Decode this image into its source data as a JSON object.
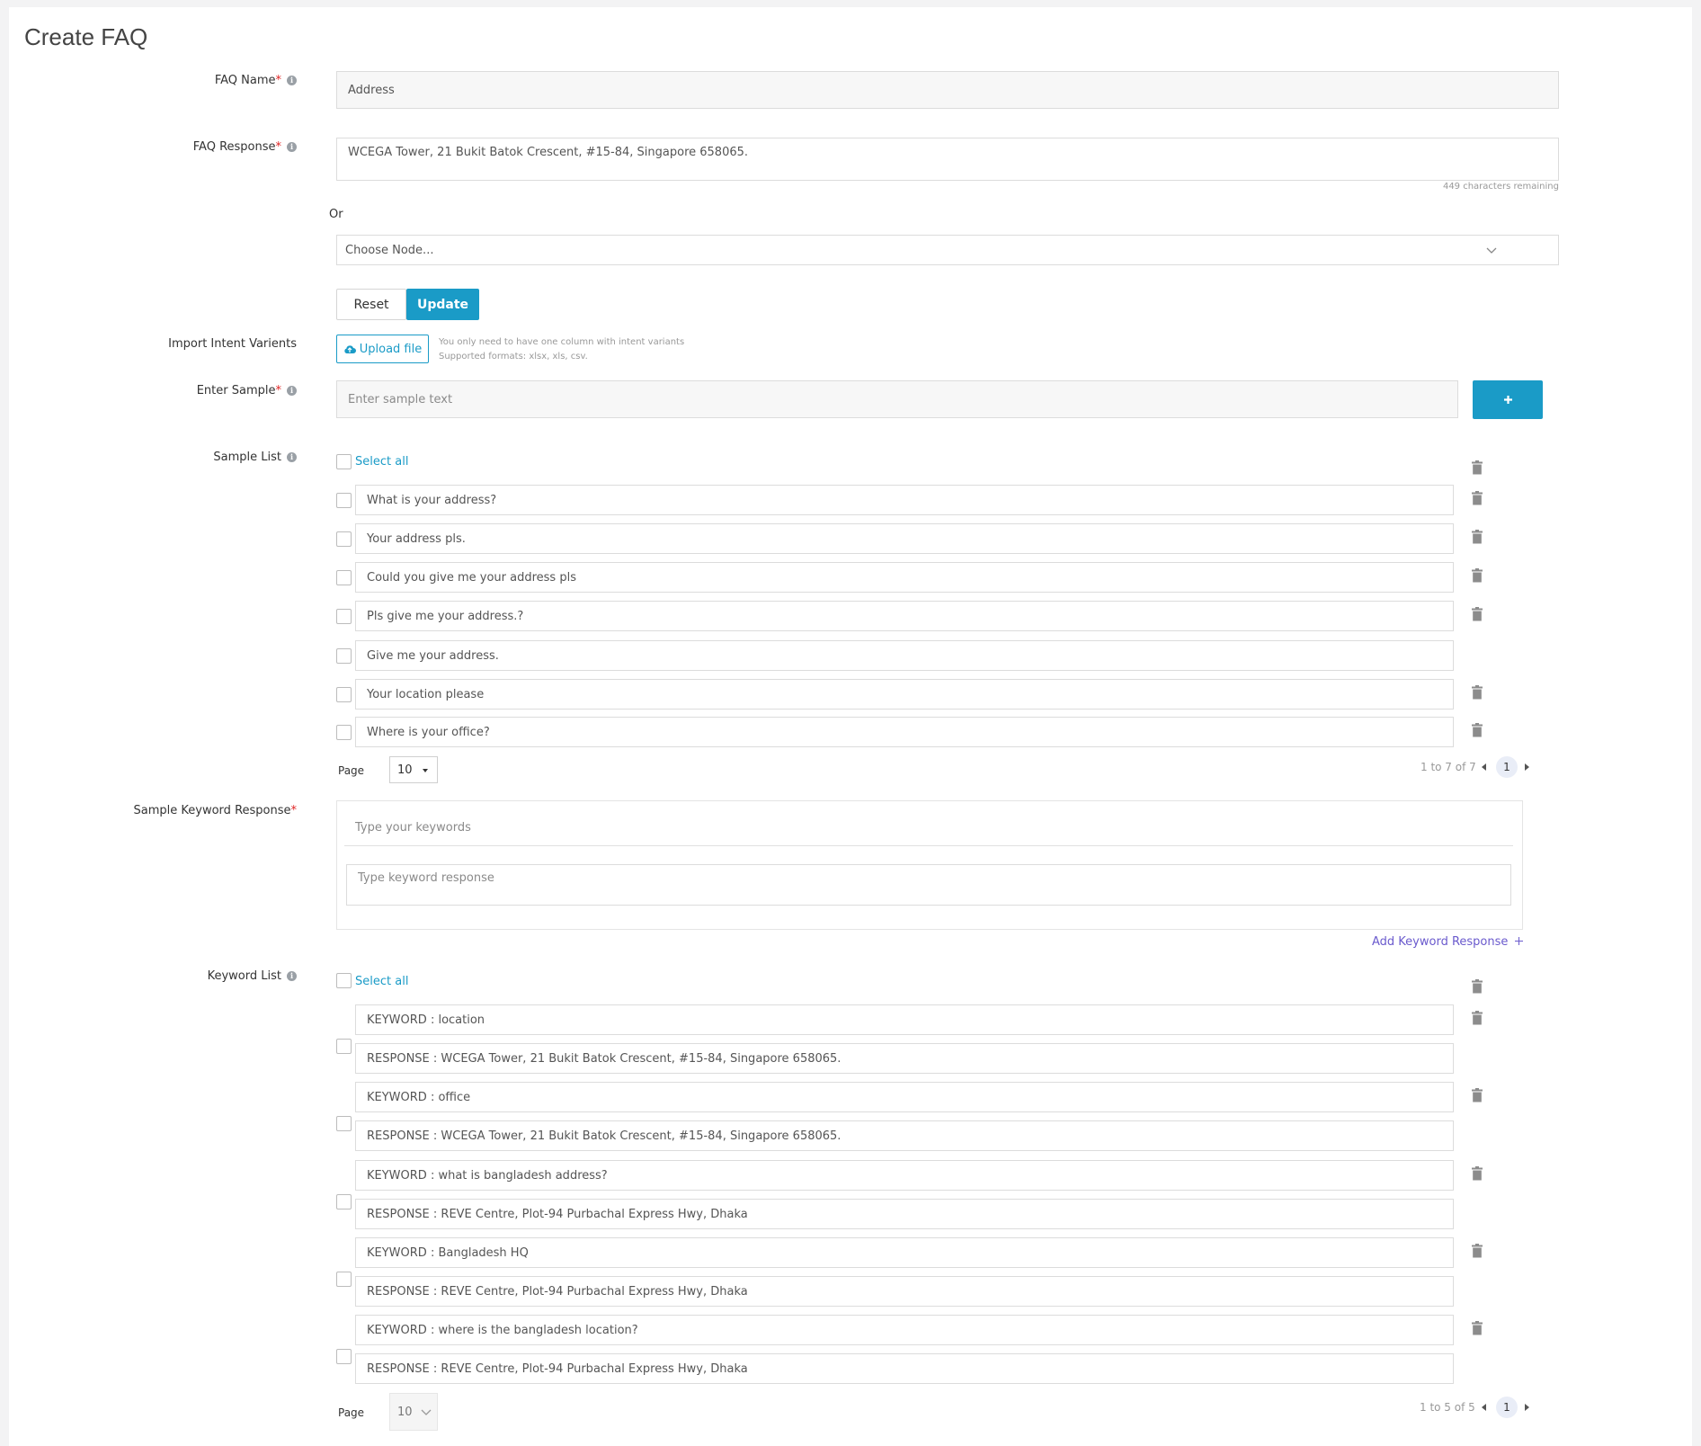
{
  "page": {
    "title": "Create FAQ"
  },
  "faq_name": {
    "label": "FAQ Name",
    "value": "Address"
  },
  "faq_response": {
    "label": "FAQ Response",
    "value": "WCEGA Tower, 21 Bukit Batok Crescent, #15-84, Singapore 658065.",
    "remaining": "449 characters remaining"
  },
  "or_text": "Or",
  "node_select": {
    "placeholder": "Choose Node..."
  },
  "buttons": {
    "reset": "Reset",
    "update": "Update",
    "add_sample": "+"
  },
  "import": {
    "label": "Import Intent Varients",
    "upload": "Upload file",
    "hint1": "You only need to have one column with intent variants",
    "hint2": "Supported formats: xlsx, xls, csv."
  },
  "sample_entry": {
    "label": "Enter Sample",
    "placeholder": "Enter sample text"
  },
  "sample_list": {
    "label": "Sample List",
    "select_all": "Select all",
    "items": [
      "What is your address?",
      "Your address pls.",
      "Could you give me your address pls",
      "Pls give me your address.?",
      "Give me your address.",
      "Your location please",
      "Where is your office?"
    ],
    "page_label": "Page",
    "page_size": "10",
    "range": "1 to 7 of 7",
    "current_page": "1"
  },
  "keyword_response": {
    "label": "Sample Keyword Response",
    "keywords_placeholder": "Type your keywords",
    "response_placeholder": "Type keyword response",
    "add_link": "Add Keyword Response"
  },
  "keyword_list": {
    "label": "Keyword List",
    "select_all": "Select all",
    "items": [
      {
        "keyword": "KEYWORD : location",
        "response": "RESPONSE : WCEGA Tower, 21 Bukit Batok Crescent, #15-84, Singapore 658065."
      },
      {
        "keyword": "KEYWORD : office",
        "response": "RESPONSE : WCEGA Tower, 21 Bukit Batok Crescent, #15-84, Singapore 658065."
      },
      {
        "keyword": "KEYWORD : what is bangladesh address?",
        "response": "RESPONSE : REVE Centre, Plot-94 Purbachal Express Hwy, Dhaka"
      },
      {
        "keyword": "KEYWORD : Bangladesh HQ",
        "response": "RESPONSE : REVE Centre, Plot-94 Purbachal Express Hwy, Dhaka"
      },
      {
        "keyword": "KEYWORD : where is the bangladesh location?",
        "response": "RESPONSE : REVE Centre, Plot-94 Purbachal Express Hwy, Dhaka"
      }
    ],
    "page_label": "Page",
    "page_size": "10",
    "range": "1 to 5 of 5",
    "current_page": "1"
  },
  "colors": {
    "accent": "#1a9bc7",
    "required": "#e02424",
    "link_purple": "#6a5acd"
  },
  "icons": [
    "info-icon",
    "chevron-down-icon",
    "cloud-upload-icon",
    "plus-icon",
    "trash-icon",
    "caret-left-icon",
    "caret-right-icon"
  ]
}
